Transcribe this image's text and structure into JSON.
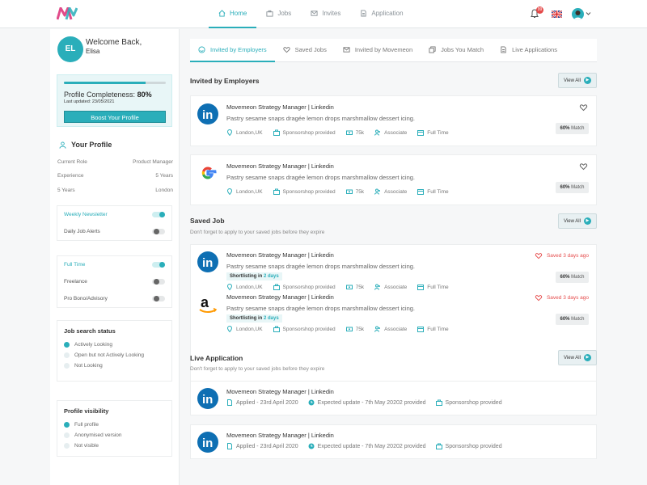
{
  "colors": {
    "accent": "#2aaeba",
    "danger": "#e54b4b",
    "brand_logo": "#e14b8a"
  },
  "header": {
    "nav": [
      {
        "label": "Home",
        "icon": "home-icon",
        "active": true
      },
      {
        "label": "Jobs",
        "icon": "briefcase-icon",
        "active": false
      },
      {
        "label": "Invites",
        "icon": "envelope-icon",
        "active": false
      },
      {
        "label": "Application",
        "icon": "document-icon",
        "active": false
      }
    ],
    "notification_count": "99"
  },
  "sidebar": {
    "avatar_initials": "EL",
    "welcome": "Welcome Back,",
    "name": "Elisa",
    "profile": {
      "progress": 0.8,
      "completeness_label": "Profile Completeness:",
      "completeness_value": "80%",
      "last_updated": "Last updated: 23/05/2021",
      "boost_label": "Boost Your Profile"
    },
    "your_profile_title": "Your Profile",
    "details": [
      {
        "key": "Current Role",
        "value": "Product Manager"
      },
      {
        "key": "Experience",
        "value": "5 Years"
      },
      {
        "key": "5 Years",
        "value": "London"
      }
    ],
    "alerts": [
      {
        "label": "Weekly Newsletter",
        "on": true
      },
      {
        "label": "Daily Job Alerts",
        "on": false
      }
    ],
    "work_type": [
      {
        "label": "Full Time",
        "on": true
      },
      {
        "label": "Freelance",
        "on": false
      },
      {
        "label": "Pro Bono/Advisory",
        "on": false
      }
    ],
    "job_search": {
      "title": "Job search status",
      "options": [
        {
          "label": "Actively Looking",
          "selected": true
        },
        {
          "label": "Open but not Actively Looking",
          "selected": false
        },
        {
          "label": "Not Looking",
          "selected": false
        }
      ]
    },
    "visibility": {
      "title": "Profile visibility",
      "options": [
        {
          "label": "Full profile",
          "selected": true
        },
        {
          "label": "Anonymised version",
          "selected": false
        },
        {
          "label": "Not visible",
          "selected": false
        }
      ]
    }
  },
  "tabs": [
    {
      "label": "Invited by Employers",
      "icon": "smiley-icon",
      "active": true
    },
    {
      "label": "Saved Jobs",
      "icon": "heart-icon",
      "active": false
    },
    {
      "label": "Invited by Movemeon",
      "icon": "envelope-icon",
      "active": false
    },
    {
      "label": "Jobs You Match",
      "icon": "copy-icon",
      "active": false
    },
    {
      "label": "Live Applications",
      "icon": "document-icon",
      "active": false
    }
  ],
  "view_all": "View All",
  "invited": {
    "title": "Invited by Employers",
    "cards": [
      {
        "logo": "linkedin-logo",
        "title": "Movemeon Strategy Manager | Linkedin",
        "desc": "Pastry sesame snaps dragée lemon drops marshmallow dessert icing.",
        "location": "London,UK",
        "sponsorship": "Sponsorshop provided",
        "salary": "75k",
        "level": "Associate",
        "type": "Full Time",
        "match_value": "60%",
        "match_label": "Match"
      },
      {
        "logo": "google-logo",
        "title": "Movemeon Strategy Manager | Linkedin",
        "desc": "Pastry sesame snaps dragée lemon drops marshmallow dessert icing.",
        "location": "London,UK",
        "sponsorship": "Sponsorshop provided",
        "salary": "75k",
        "level": "Associate",
        "type": "Full Time",
        "match_value": "60%",
        "match_label": "Match"
      }
    ]
  },
  "saved": {
    "title": "Saved Job",
    "subtitle": "Don't forget to apply to your saved jobs before they expire",
    "cards": [
      {
        "logo": "linkedin-logo",
        "title": "Movemeon Strategy Manager | Linkedin",
        "desc": "Pastry sesame snaps dragée lemon drops marshmallow dessert icing.",
        "shortlist_label": "Shortlisting in",
        "shortlist_days": "2 days",
        "saved_ago": "Saved 3 days ago",
        "location": "London,UK",
        "sponsorship": "Sponsorshop provided",
        "salary": "75k",
        "level": "Associate",
        "type": "Full Time",
        "match_value": "60%",
        "match_label": "Match"
      },
      {
        "logo": "amazon-logo",
        "title": "Movemeon Strategy Manager | Linkedin",
        "desc": "Pastry sesame snaps dragée lemon drops marshmallow dessert icing.",
        "shortlist_label": "Shortlisting in",
        "shortlist_days": "2 days",
        "saved_ago": "Saved 3 days ago",
        "location": "London,UK",
        "sponsorship": "Sponsorshop provided",
        "salary": "75k",
        "level": "Associate",
        "type": "Full Time",
        "match_value": "60%",
        "match_label": "Match"
      }
    ]
  },
  "live": {
    "title": "Live Application",
    "subtitle": "Don't forget to apply to your saved jobs before they expire",
    "cards": [
      {
        "logo": "linkedin-logo",
        "title": "Movemeon Strategy Manager | Linkedin",
        "applied": "Applied - 23rd April 2020",
        "expected": "Expected update - 7th May 20202 provided",
        "sponsorship": "Sponsorshop provided"
      },
      {
        "logo": "linkedin-logo",
        "title": "Movemeon Strategy Manager | Linkedin",
        "applied": "Applied - 23rd April 2020",
        "expected": "Expected update - 7th May 20202 provided",
        "sponsorship": "Sponsorshop provided"
      }
    ]
  }
}
